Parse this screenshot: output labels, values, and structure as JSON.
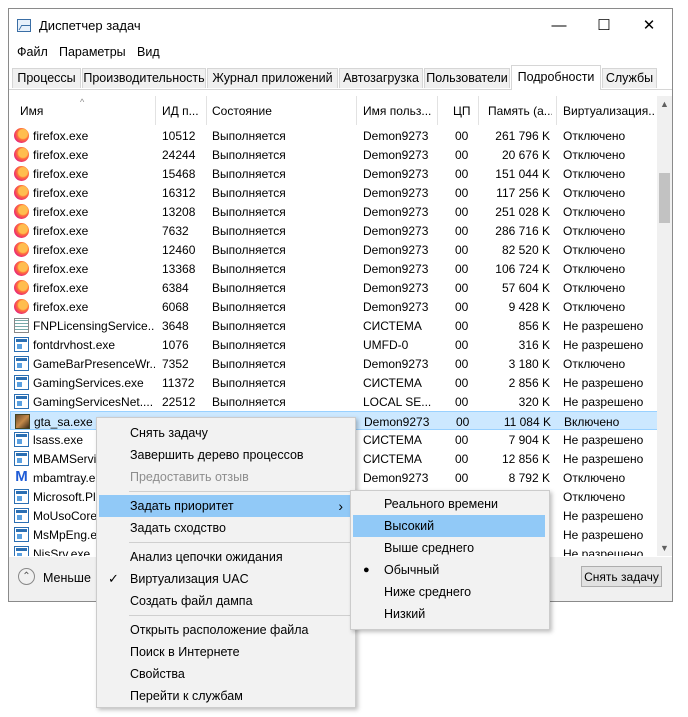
{
  "window": {
    "title": "Диспетчер задач",
    "controls": {
      "minimize": "—",
      "maximize": "☐",
      "close": "✕"
    }
  },
  "menu": [
    "Файл",
    "Параметры",
    "Вид"
  ],
  "tabs": [
    "Процессы",
    "Производительность",
    "Журнал приложений",
    "Автозагрузка",
    "Пользователи",
    "Подробности",
    "Службы"
  ],
  "active_tab": "Подробности",
  "columns": [
    "Имя",
    "ИД п...",
    "Состояние",
    "Имя польз...",
    "ЦП",
    "Память (а...",
    "Виртуализация..."
  ],
  "rows": [
    {
      "icon": "firefox-icon",
      "name": "firefox.exe",
      "pid": "10512",
      "status": "Выполняется",
      "user": "Demon9273",
      "cpu": "00",
      "mem": "261 796 K",
      "virt": "Отключено"
    },
    {
      "icon": "firefox-icon",
      "name": "firefox.exe",
      "pid": "24244",
      "status": "Выполняется",
      "user": "Demon9273",
      "cpu": "00",
      "mem": "20 676 K",
      "virt": "Отключено"
    },
    {
      "icon": "firefox-icon",
      "name": "firefox.exe",
      "pid": "15468",
      "status": "Выполняется",
      "user": "Demon9273",
      "cpu": "00",
      "mem": "151 044 K",
      "virt": "Отключено"
    },
    {
      "icon": "firefox-icon",
      "name": "firefox.exe",
      "pid": "16312",
      "status": "Выполняется",
      "user": "Demon9273",
      "cpu": "00",
      "mem": "117 256 K",
      "virt": "Отключено"
    },
    {
      "icon": "firefox-icon",
      "name": "firefox.exe",
      "pid": "13208",
      "status": "Выполняется",
      "user": "Demon9273",
      "cpu": "00",
      "mem": "251 028 K",
      "virt": "Отключено"
    },
    {
      "icon": "firefox-icon",
      "name": "firefox.exe",
      "pid": "7632",
      "status": "Выполняется",
      "user": "Demon9273",
      "cpu": "00",
      "mem": "286 716 K",
      "virt": "Отключено"
    },
    {
      "icon": "firefox-icon",
      "name": "firefox.exe",
      "pid": "12460",
      "status": "Выполняется",
      "user": "Demon9273",
      "cpu": "00",
      "mem": "82 520 K",
      "virt": "Отключено"
    },
    {
      "icon": "firefox-icon",
      "name": "firefox.exe",
      "pid": "13368",
      "status": "Выполняется",
      "user": "Demon9273",
      "cpu": "00",
      "mem": "106 724 K",
      "virt": "Отключено"
    },
    {
      "icon": "firefox-icon",
      "name": "firefox.exe",
      "pid": "6384",
      "status": "Выполняется",
      "user": "Demon9273",
      "cpu": "00",
      "mem": "57 604 K",
      "virt": "Отключено"
    },
    {
      "icon": "firefox-icon",
      "name": "firefox.exe",
      "pid": "6068",
      "status": "Выполняется",
      "user": "Demon9273",
      "cpu": "00",
      "mem": "9 428 K",
      "virt": "Отключено"
    },
    {
      "icon": "licensing-icon",
      "name": "FNPLicensingService...",
      "pid": "3648",
      "status": "Выполняется",
      "user": "СИСТЕМА",
      "cpu": "00",
      "mem": "856 K",
      "virt": "Не разрешено"
    },
    {
      "icon": "window-icon",
      "name": "fontdrvhost.exe",
      "pid": "1076",
      "status": "Выполняется",
      "user": "UMFD-0",
      "cpu": "00",
      "mem": "316 K",
      "virt": "Не разрешено"
    },
    {
      "icon": "window-icon",
      "name": "GameBarPresenceWr...",
      "pid": "7352",
      "status": "Выполняется",
      "user": "Demon9273",
      "cpu": "00",
      "mem": "3 180 K",
      "virt": "Отключено"
    },
    {
      "icon": "window-icon",
      "name": "GamingServices.exe",
      "pid": "11372",
      "status": "Выполняется",
      "user": "СИСТЕМА",
      "cpu": "00",
      "mem": "2 856 K",
      "virt": "Не разрешено"
    },
    {
      "icon": "window-icon",
      "name": "GamingServicesNet....",
      "pid": "22512",
      "status": "Выполняется",
      "user": "LOCAL SE...",
      "cpu": "00",
      "mem": "320 K",
      "virt": "Не разрешено"
    },
    {
      "icon": "gta-icon",
      "name": "gta_sa.exe",
      "pid": "",
      "status": "",
      "user": "Demon9273",
      "cpu": "00",
      "mem": "11 084 K",
      "virt": "Включено",
      "selected": true
    },
    {
      "icon": "window-icon",
      "name": "lsass.exe",
      "pid": "",
      "status": "",
      "user": "СИСТЕМА",
      "cpu": "00",
      "mem": "7 904 K",
      "virt": "Не разрешено"
    },
    {
      "icon": "window-icon",
      "name": "MBAMServi",
      "pid": "",
      "status": "",
      "user": "СИСТЕМА",
      "cpu": "00",
      "mem": "12 856 K",
      "virt": "Не разрешено"
    },
    {
      "icon": "malwarebytes-icon",
      "name": "mbamtray.e",
      "pid": "",
      "status": "",
      "user": "Demon9273",
      "cpu": "00",
      "mem": "8 792 K",
      "virt": "Отключено"
    },
    {
      "icon": "window-icon",
      "name": "Microsoft.Pl",
      "pid": "",
      "status": "",
      "user": "",
      "cpu": "",
      "mem": "",
      "virt": "Отключено"
    },
    {
      "icon": "window-icon",
      "name": "MoUsoCore",
      "pid": "",
      "status": "",
      "user": "",
      "cpu": "",
      "mem": "",
      "virt": "Не разрешено"
    },
    {
      "icon": "window-icon",
      "name": "MsMpEng.e",
      "pid": "",
      "status": "",
      "user": "",
      "cpu": "",
      "mem": "",
      "virt": "Не разрешено"
    },
    {
      "icon": "window-icon",
      "name": "NisSrv.exe",
      "pid": "",
      "status": "",
      "user": "",
      "cpu": "",
      "mem": "",
      "virt": "Не разрешено"
    }
  ],
  "footer": {
    "less_label": "Меньше",
    "end_task_label": "Снять задачу"
  },
  "context_menu": {
    "items": [
      {
        "label": "Снять задачу"
      },
      {
        "label": "Завершить дерево процессов"
      },
      {
        "label": "Предоставить отзыв",
        "disabled": true
      },
      {
        "separator": true
      },
      {
        "label": "Задать приоритет",
        "submenu": true,
        "highlighted": true
      },
      {
        "label": "Задать сходство"
      },
      {
        "separator": true
      },
      {
        "label": "Анализ цепочки ожидания"
      },
      {
        "label": "Виртуализация UAC",
        "checked": true
      },
      {
        "label": "Создать файл дампа"
      },
      {
        "separator": true
      },
      {
        "label": "Открыть расположение файла"
      },
      {
        "label": "Поиск в Интернете"
      },
      {
        "label": "Свойства"
      },
      {
        "label": "Перейти к службам"
      }
    ]
  },
  "priority_submenu": {
    "items": [
      {
        "label": "Реального времени"
      },
      {
        "label": "Высокий",
        "highlighted": true
      },
      {
        "label": "Выше среднего"
      },
      {
        "label": "Обычный",
        "selected": true
      },
      {
        "label": "Ниже среднего"
      },
      {
        "label": "Низкий"
      }
    ]
  },
  "colors": {
    "selection": "#cce8ff",
    "menu_highlight": "#91c9f7",
    "menu_bg": "#f2f2f2"
  }
}
